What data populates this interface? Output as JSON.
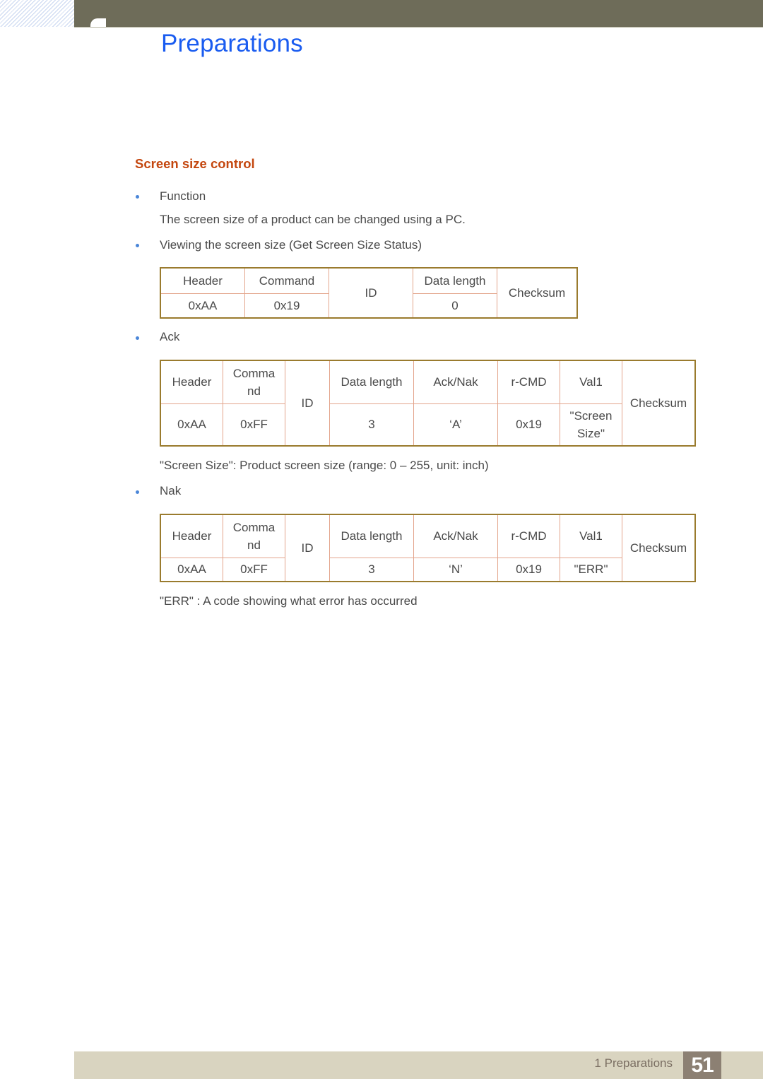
{
  "header": {
    "chapter_title": "Preparations"
  },
  "section": {
    "title": "Screen size control",
    "function_bullet": "Function",
    "function_desc": "The screen size of a product can be changed using a PC.",
    "viewing_bullet": "Viewing the screen size (Get Screen Size Status)",
    "ack_bullet": "Ack",
    "screen_size_note": "\"Screen Size\": Product screen size (range: 0 – 255, unit: inch)",
    "nak_bullet": "Nak",
    "err_note": "\"ERR\" : A code showing what error has occurred"
  },
  "get_table": {
    "header": "Header",
    "command": "Command",
    "id": "ID",
    "data_length": "Data length",
    "checksum": "Checksum",
    "header_val": "0xAA",
    "command_val": "0x19",
    "data_length_val": "0"
  },
  "ack_table": {
    "header": "Header",
    "command_l1": "Comma",
    "command_l2": "nd",
    "id": "ID",
    "data_length": "Data length",
    "ack_nak": "Ack/Nak",
    "rcmd": "r-CMD",
    "val1": "Val1",
    "checksum": "Checksum",
    "header_val": "0xAA",
    "command_val": "0xFF",
    "data_length_val": "3",
    "ack_nak_val": "‘A’",
    "rcmd_val": "0x19",
    "val1_l1": "\"Screen",
    "val1_l2": "Size\""
  },
  "nak_table": {
    "header": "Header",
    "command_l1": "Comma",
    "command_l2": "nd",
    "id": "ID",
    "data_length": "Data length",
    "ack_nak": "Ack/Nak",
    "rcmd": "r-CMD",
    "val1": "Val1",
    "checksum": "Checksum",
    "header_val": "0xAA",
    "command_val": "0xFF",
    "data_length_val": "3",
    "ack_nak_val": "‘N’",
    "rcmd_val": "0x19",
    "val1_val": "\"ERR\""
  },
  "footer": {
    "chapter_label": "1 Preparations",
    "page_number": "51"
  }
}
